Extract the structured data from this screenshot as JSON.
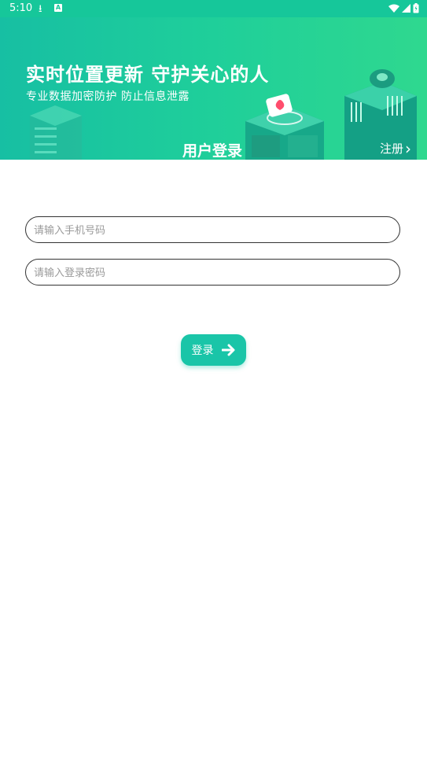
{
  "status_bar": {
    "time": "5:10",
    "a_icon_letter": "A"
  },
  "banner": {
    "slogan": "实时位置更新 守护关心的人",
    "subslogan": "专业数据加密防护 防止信息泄露",
    "page_title": "用户登录",
    "register_label": "注册"
  },
  "form": {
    "phone_placeholder": "请输入手机号码",
    "password_placeholder": "请输入登录密码",
    "login_label": "登录"
  },
  "colors": {
    "accent": "#1ac5a8",
    "status_bar": "#16c79a"
  }
}
